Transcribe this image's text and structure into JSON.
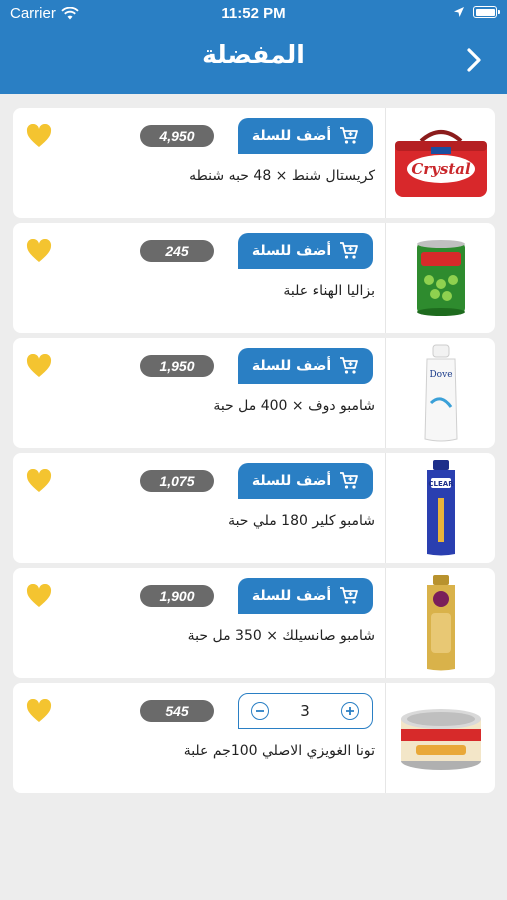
{
  "status_bar": {
    "carrier": "Carrier",
    "time": "11:52 PM"
  },
  "header": {
    "title": "المفضلة"
  },
  "colors": {
    "primary": "#2a7fc4",
    "heart": "#f4c430",
    "price_badge": "#6a6a6a",
    "background": "#ededed"
  },
  "add_to_cart_label": "أضف للسلة",
  "products": [
    {
      "name": "كريستال شنط × 48 حبه شنطه",
      "price": "4,950",
      "image_icon": "crystal-bag-icon",
      "in_cart": false
    },
    {
      "name": "بزاليا الهناء علبة",
      "price": "245",
      "image_icon": "peas-can-icon",
      "in_cart": false
    },
    {
      "name": "شامبو دوف × 400 مل حبة",
      "price": "1,950",
      "image_icon": "dove-shampoo-icon",
      "in_cart": false
    },
    {
      "name": "شامبو كلير 180 ملي حبة",
      "price": "1,075",
      "image_icon": "clear-shampoo-icon",
      "in_cart": false
    },
    {
      "name": "شامبو صانسيلك × 350 مل حبة",
      "price": "1,900",
      "image_icon": "sunsilk-shampoo-icon",
      "in_cart": false
    },
    {
      "name": "تونا الغويزي الاصلي 100جم علبة",
      "price": "545",
      "image_icon": "tuna-can-icon",
      "in_cart": true,
      "quantity": "3"
    }
  ]
}
